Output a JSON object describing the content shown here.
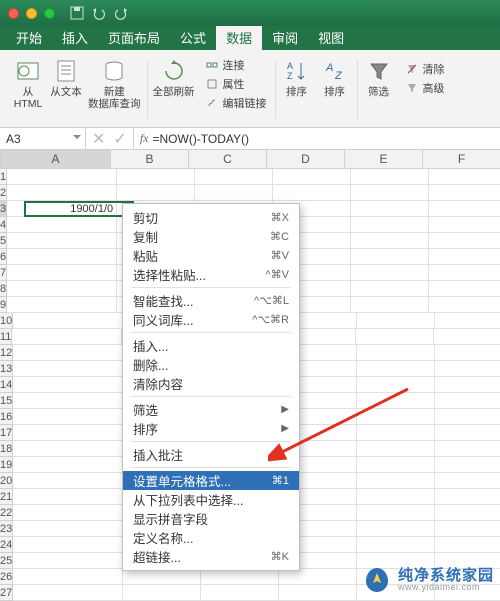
{
  "tabs": [
    "开始",
    "插入",
    "页面布局",
    "公式",
    "数据",
    "审阅",
    "视图"
  ],
  "active_tab_index": 4,
  "ribbon": {
    "from_html": "从\nHTML",
    "from_text": "从文本",
    "new_db_query": "新建\n数据库查询",
    "refresh_all": "全部刷新",
    "connections": "连接",
    "properties": "属性",
    "edit_links": "编辑链接",
    "sort_az": "排序",
    "sort": "排序",
    "filter": "筛选",
    "clear": "清除",
    "advanced": "高级"
  },
  "namebox": "A3",
  "formula": "=NOW()-TODAY()",
  "columns": [
    "A",
    "B",
    "C",
    "D",
    "E",
    "F"
  ],
  "selected_col": "A",
  "selected_row": 3,
  "row_count": 27,
  "cell_a3": "1900/1/0",
  "context_menu": [
    {
      "label": "剪切",
      "shortcut": "⌘X"
    },
    {
      "label": "复制",
      "shortcut": "⌘C"
    },
    {
      "label": "粘贴",
      "shortcut": "⌘V"
    },
    {
      "label": "选择性粘贴...",
      "shortcut": "^⌘V"
    },
    {
      "sep": true
    },
    {
      "label": "智能查找...",
      "shortcut": "^⌥⌘L"
    },
    {
      "label": "同义词库...",
      "shortcut": "^⌥⌘R"
    },
    {
      "sep": true
    },
    {
      "label": "插入..."
    },
    {
      "label": "删除..."
    },
    {
      "label": "清除内容"
    },
    {
      "sep": true
    },
    {
      "label": "筛选",
      "submenu": true
    },
    {
      "label": "排序",
      "submenu": true
    },
    {
      "sep": true
    },
    {
      "label": "插入批注"
    },
    {
      "sep": true
    },
    {
      "label": "设置单元格格式...",
      "shortcut": "⌘1",
      "highlight": true
    },
    {
      "label": "从下拉列表中选择..."
    },
    {
      "label": "显示拼音字段"
    },
    {
      "label": "定义名称..."
    },
    {
      "label": "超链接...",
      "shortcut": "⌘K"
    }
  ],
  "watermark": {
    "line1": "纯净系统家园",
    "line2": "www.yidaimei.com"
  }
}
